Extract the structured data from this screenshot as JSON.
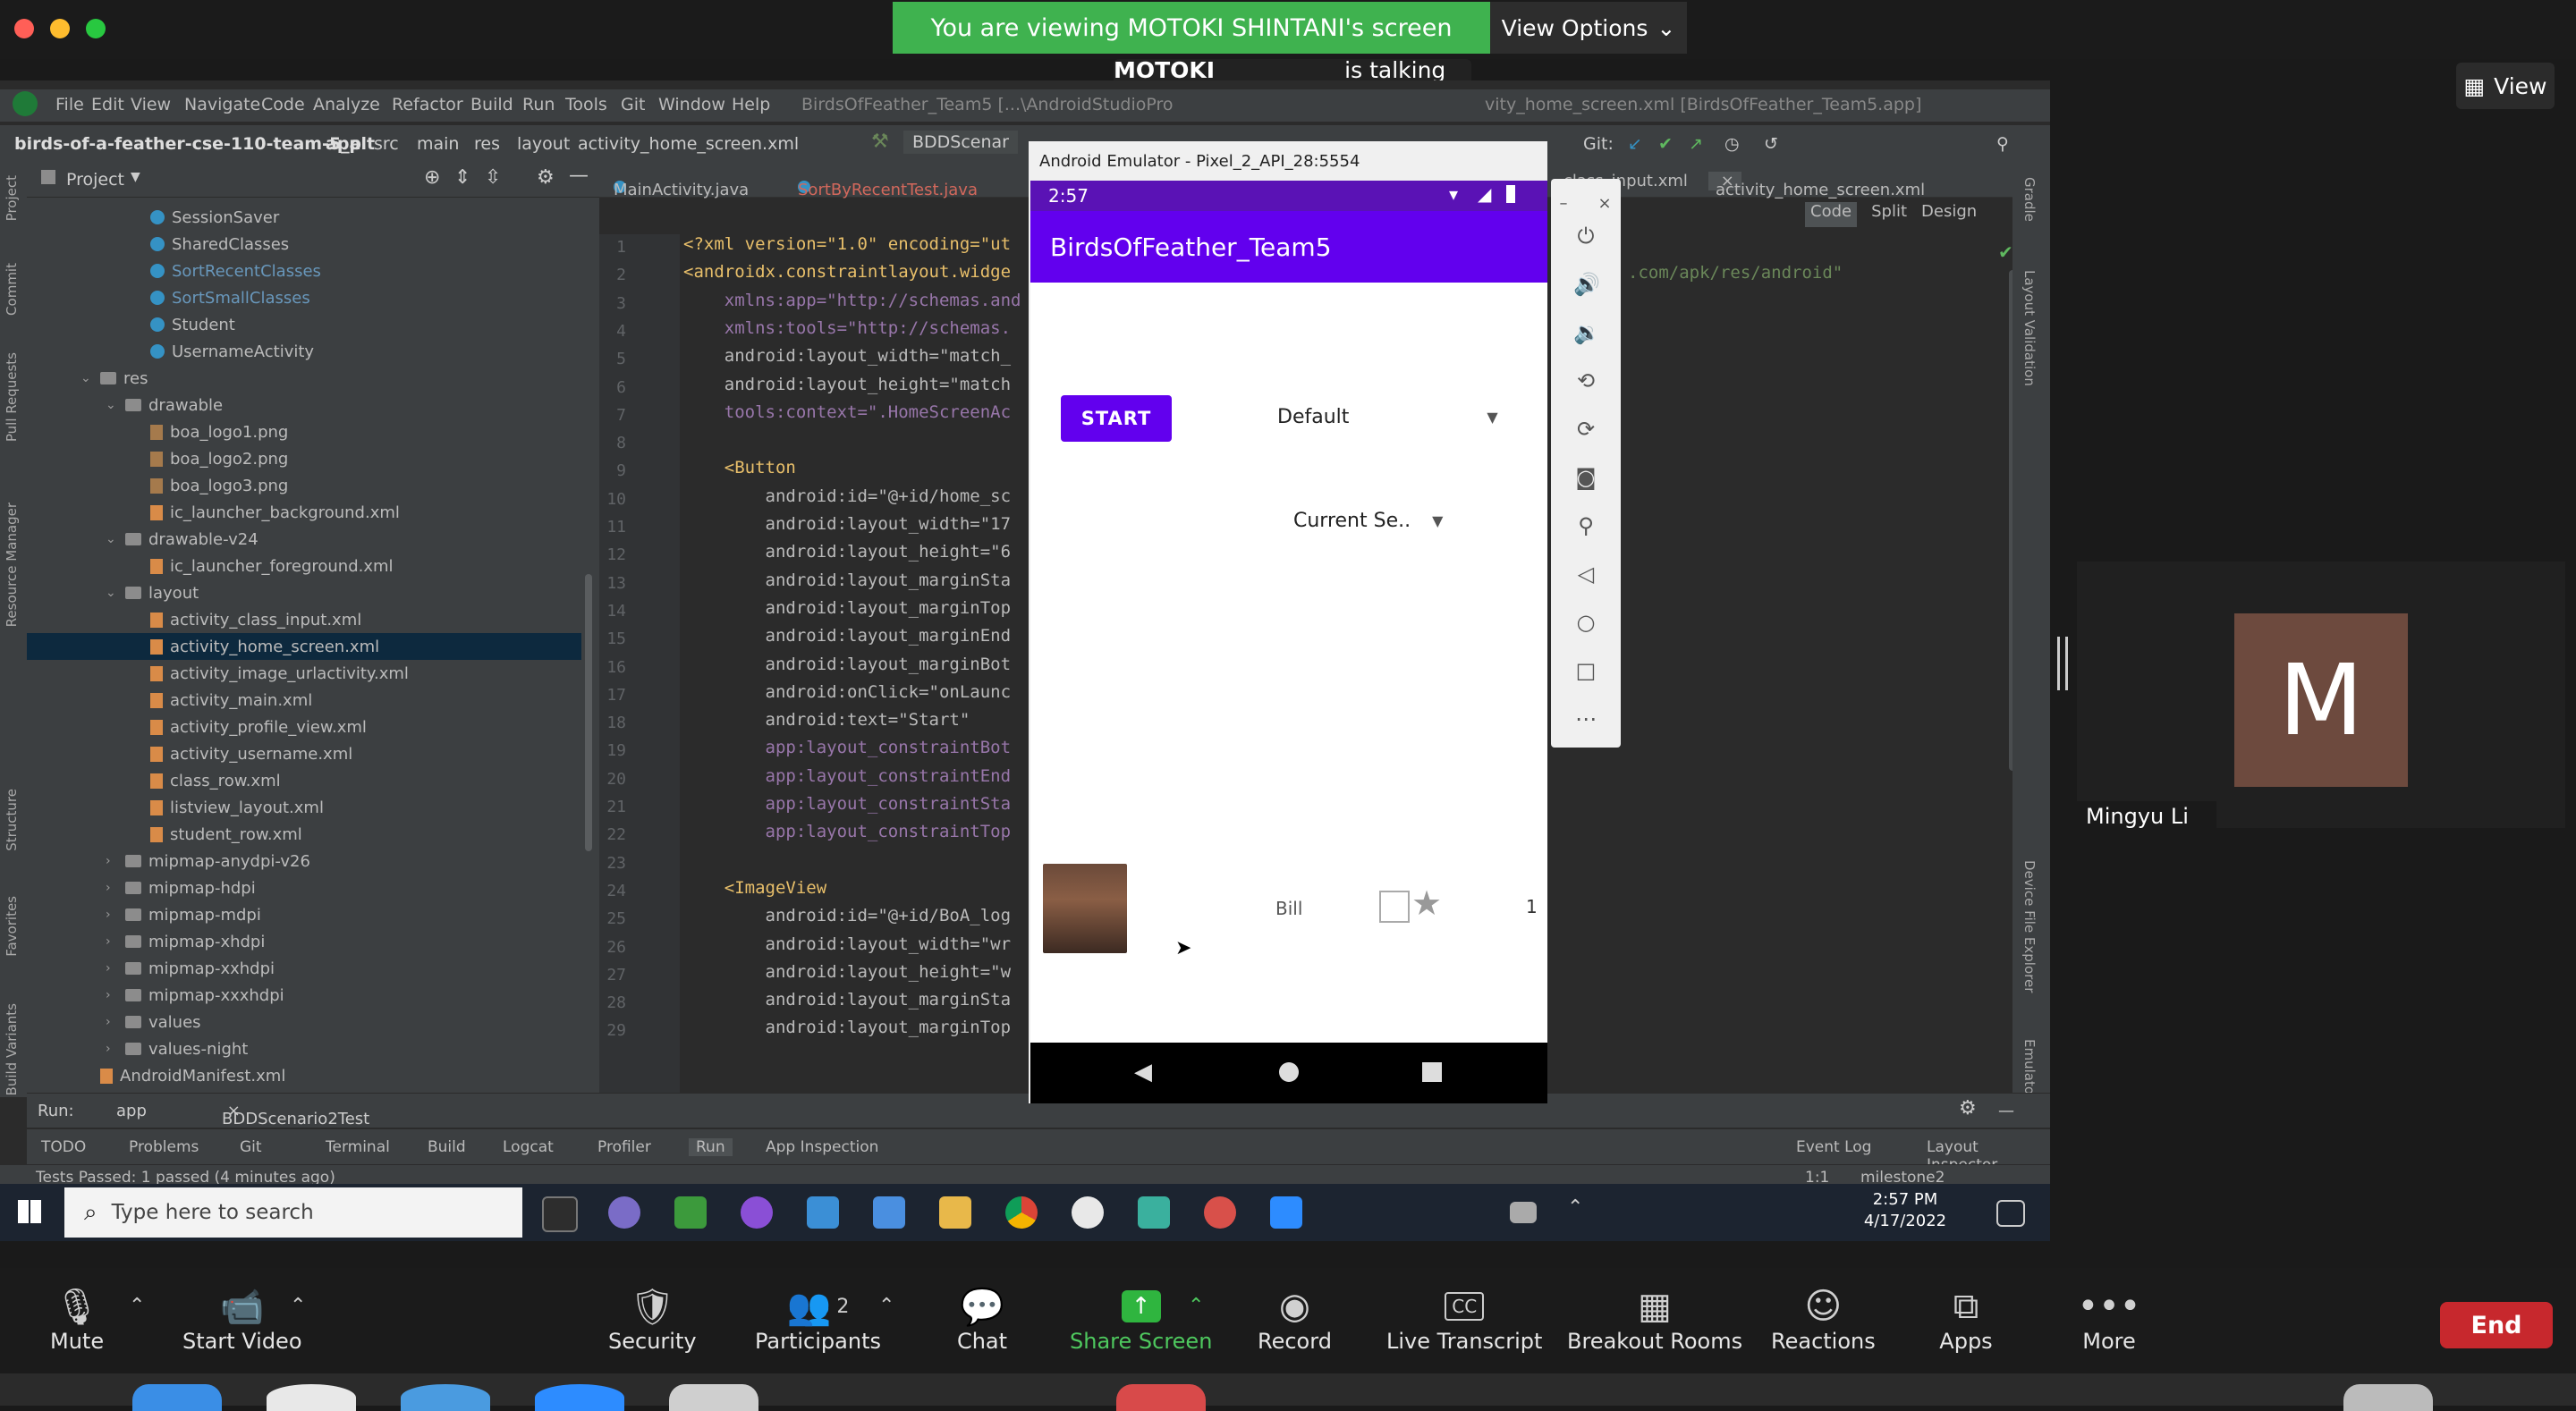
{
  "zoom": {
    "share_banner": "You are viewing MOTOKI SHINTANI's screen",
    "view_options": "View Options",
    "talking": "is talking ...",
    "talking_name": "MOTOKI SHINTANI",
    "view_button": "View",
    "participant_initial": "M",
    "participant_name": "Mingyu Li",
    "toolbar": {
      "mute": "Mute",
      "start_video": "Start Video",
      "security": "Security",
      "participants": "Participants",
      "participants_count": "2",
      "chat": "Chat",
      "share_screen": "Share Screen",
      "record": "Record",
      "live_transcript": "Live Transcript",
      "breakout_rooms": "Breakout Rooms",
      "reactions": "Reactions",
      "apps": "Apps",
      "more": "More",
      "end": "End"
    }
  },
  "ide": {
    "menu": [
      "File",
      "Edit",
      "View",
      "Navigate",
      "Code",
      "Analyze",
      "Refactor",
      "Build",
      "Run",
      "Tools",
      "Git",
      "Window",
      "Help"
    ],
    "title": "BirdsOfFeather_Team5 [...\\AndroidStudioPro",
    "title_right": "vity_home_screen.xml [BirdsOfFeather_Team5.app]",
    "breadcrumb": [
      "birds-of-a-feather-cse-110-team-5_alt",
      "app",
      "src",
      "main",
      "res",
      "layout",
      "activity_home_screen.xml"
    ],
    "run_config": "BDDScenar",
    "git_label": "Git:",
    "project_label": "Project",
    "tree": [
      {
        "label": "SessionSaver",
        "type": "class",
        "indent": 3
      },
      {
        "label": "SharedClasses",
        "type": "class",
        "indent": 3
      },
      {
        "label": "SortRecentClasses",
        "type": "class-blue",
        "indent": 3
      },
      {
        "label": "SortSmallClasses",
        "type": "class-blue",
        "indent": 3
      },
      {
        "label": "Student",
        "type": "class",
        "indent": 3
      },
      {
        "label": "UsernameActivity",
        "type": "class",
        "indent": 3
      },
      {
        "label": "res",
        "type": "folder-open",
        "indent": 1
      },
      {
        "label": "drawable",
        "type": "folder-open",
        "indent": 2
      },
      {
        "label": "boa_logo1.png",
        "type": "file",
        "indent": 3
      },
      {
        "label": "boa_logo2.png",
        "type": "file",
        "indent": 3
      },
      {
        "label": "boa_logo3.png",
        "type": "file",
        "indent": 3
      },
      {
        "label": "ic_launcher_background.xml",
        "type": "xml",
        "indent": 3
      },
      {
        "label": "drawable-v24",
        "type": "folder-open",
        "indent": 2
      },
      {
        "label": "ic_launcher_foreground.xml",
        "type": "xml",
        "indent": 3
      },
      {
        "label": "layout",
        "type": "folder-open",
        "indent": 2
      },
      {
        "label": "activity_class_input.xml",
        "type": "xml",
        "indent": 3
      },
      {
        "label": "activity_home_screen.xml",
        "type": "xml",
        "indent": 3,
        "selected": true
      },
      {
        "label": "activity_image_urlactivity.xml",
        "type": "xml",
        "indent": 3
      },
      {
        "label": "activity_main.xml",
        "type": "xml",
        "indent": 3
      },
      {
        "label": "activity_profile_view.xml",
        "type": "xml",
        "indent": 3
      },
      {
        "label": "activity_username.xml",
        "type": "xml",
        "indent": 3
      },
      {
        "label": "class_row.xml",
        "type": "xml",
        "indent": 3
      },
      {
        "label": "listview_layout.xml",
        "type": "xml",
        "indent": 3
      },
      {
        "label": "student_row.xml",
        "type": "xml",
        "indent": 3
      },
      {
        "label": "mipmap-anydpi-v26",
        "type": "folder",
        "indent": 2
      },
      {
        "label": "mipmap-hdpi",
        "type": "folder",
        "indent": 2
      },
      {
        "label": "mipmap-mdpi",
        "type": "folder",
        "indent": 2
      },
      {
        "label": "mipmap-xhdpi",
        "type": "folder",
        "indent": 2
      },
      {
        "label": "mipmap-xxhdpi",
        "type": "folder",
        "indent": 2
      },
      {
        "label": "mipmap-xxxhdpi",
        "type": "folder",
        "indent": 2
      },
      {
        "label": "values",
        "type": "folder",
        "indent": 2
      },
      {
        "label": "values-night",
        "type": "folder",
        "indent": 2
      },
      {
        "label": "AndroidManifest.xml",
        "type": "xml",
        "indent": 1
      }
    ],
    "tabs": [
      "MainActivity.java",
      "SortByRecentTest.java",
      "class_input.xml",
      "activity_home_screen.xml"
    ],
    "view_modes": [
      "Code",
      "Split",
      "Design"
    ],
    "code": [
      {
        "n": "1",
        "t": "<?xml version=\"1.0\" encoding=\"ut"
      },
      {
        "n": "2",
        "t": "<androidx.constraintlayout.widge"
      },
      {
        "n": "3",
        "t": "    xmlns:app=\"http://schemas.and"
      },
      {
        "n": "4",
        "t": "    xmlns:tools=\"http://schemas."
      },
      {
        "n": "5",
        "t": "    android:layout_width=\"match_"
      },
      {
        "n": "6",
        "t": "    android:layout_height=\"match"
      },
      {
        "n": "7",
        "t": "    tools:context=\".HomeScreenAc"
      },
      {
        "n": "8",
        "t": ""
      },
      {
        "n": "9",
        "t": "    <Button"
      },
      {
        "n": "10",
        "t": "        android:id=\"@+id/home_sc"
      },
      {
        "n": "11",
        "t": "        android:layout_width=\"17"
      },
      {
        "n": "12",
        "t": "        android:layout_height=\"6"
      },
      {
        "n": "13",
        "t": "        android:layout_marginSta"
      },
      {
        "n": "14",
        "t": "        android:layout_marginTop"
      },
      {
        "n": "15",
        "t": "        android:layout_marginEnd"
      },
      {
        "n": "16",
        "t": "        android:layout_marginBot"
      },
      {
        "n": "17",
        "t": "        android:onClick=\"onLaunc"
      },
      {
        "n": "18",
        "t": "        android:text=\"Start\""
      },
      {
        "n": "19",
        "t": "        app:layout_constraintBot"
      },
      {
        "n": "20",
        "t": "        app:layout_constraintEnd"
      },
      {
        "n": "21",
        "t": "        app:layout_constraintSta"
      },
      {
        "n": "22",
        "t": "        app:layout_constraintTop"
      },
      {
        "n": "23",
        "t": ""
      },
      {
        "n": "24",
        "t": "    <ImageView"
      },
      {
        "n": "25",
        "t": "        android:id=\"@+id/BoA_log"
      },
      {
        "n": "26",
        "t": "        android:layout_width=\"wr"
      },
      {
        "n": "27",
        "t": "        android:layout_height=\"w"
      },
      {
        "n": "28",
        "t": "        android:layout_marginSta"
      },
      {
        "n": "29",
        "t": "        android:layout_marginTop"
      }
    ],
    "code_overflow": ".com/apk/res/android\"",
    "run_label": "Run:",
    "run_tabs": [
      "app",
      "BDDScenario2Test"
    ],
    "tool_tabs": [
      "TODO",
      "Problems",
      "Git",
      "Terminal",
      "Build",
      "Logcat",
      "Profiler",
      "Run",
      "App Inspection"
    ],
    "tool_tabs_right": [
      "Event Log",
      "Layout Inspector"
    ],
    "status": "Tests Passed: 1 passed (4 minutes ago)",
    "status_right": [
      "1:1",
      "milestone2"
    ],
    "left_strip": [
      "Project",
      "Commit",
      "Pull Requests",
      "Resource Manager",
      "Structure",
      "Favorites",
      "Build Variants"
    ],
    "right_strip": [
      "Gradle",
      "Layout Validation",
      "Device File Explorer",
      "Emulator"
    ]
  },
  "emulator": {
    "title": "Android Emulator - Pixel_2_API_28:5554",
    "time": "2:57",
    "app_title": "BirdsOfFeather_Team5",
    "start_button": "START",
    "spinner_sort": "Default",
    "spinner_session": "Current Se..",
    "row_name": "Bill",
    "row_count": "1"
  },
  "windows": {
    "search_placeholder": "Type here to search",
    "time": "2:57 PM",
    "date": "4/17/2022"
  },
  "colors": {
    "zoom_green": "#3fb24f",
    "app_primary": "#6200ee",
    "end_red": "#c7282d",
    "ide_bg": "#2b2b2b"
  }
}
